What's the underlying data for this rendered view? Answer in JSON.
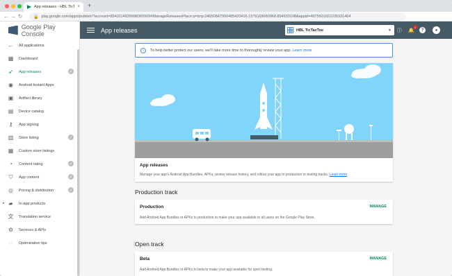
{
  "browser": {
    "tab_title": "App releases - HBL TicTacToe",
    "tab_close": "×",
    "new_tab": "+",
    "url": "play.google.com/apps/publish/?account=8943114839998365509#ManageReleasesPlace:p=tmp.04650847950485420416.1579168660968.894633108&appid=4975501822235331464"
  },
  "brand": {
    "name_part1": "Google Play",
    "name_part2": " Console"
  },
  "sidebar": {
    "items": [
      {
        "label": "All applications",
        "icon": "back-arrow-icon",
        "glyph": "←"
      },
      {
        "label": "Dashboard",
        "icon": "dashboard-icon",
        "glyph": "▦"
      },
      {
        "label": "App releases",
        "icon": "rocket-icon",
        "glyph": "➶"
      },
      {
        "label": "Android Instant Apps",
        "icon": "instant-apps-icon",
        "glyph": "◉"
      },
      {
        "label": "Artifact library",
        "icon": "artifact-icon",
        "glyph": "▣"
      },
      {
        "label": "Device catalog",
        "icon": "device-icon",
        "glyph": "▤"
      },
      {
        "label": "App signing",
        "icon": "key-icon",
        "glyph": "⚷"
      },
      {
        "label": "Store listing",
        "icon": "store-icon",
        "glyph": "▥"
      },
      {
        "label": "Custom store listings",
        "icon": "custom-listing-icon",
        "glyph": "▦"
      },
      {
        "label": "Content rating",
        "icon": "rating-icon",
        "glyph": "◔"
      },
      {
        "label": "App content",
        "icon": "shield-icon",
        "glyph": "⛉"
      },
      {
        "label": "Pricing & distribution",
        "icon": "pricing-icon",
        "glyph": "◎"
      },
      {
        "label": "In-app products",
        "icon": "cart-icon",
        "glyph": "▰"
      },
      {
        "label": "Translation service",
        "icon": "translate-icon",
        "glyph": "文"
      },
      {
        "label": "Services & APIs",
        "icon": "services-icon",
        "glyph": "⚙"
      },
      {
        "label": "Optimization tips",
        "icon": "bulb-icon",
        "glyph": "◌"
      }
    ]
  },
  "topbar": {
    "title": "App releases",
    "app_name": "HBL TicTacToe",
    "notification_count": "1"
  },
  "notice": {
    "text": "To help better protect our users, we'll take more time to thoroughly review your app. ",
    "link": "Learn more"
  },
  "hero": {
    "title": "App releases",
    "description": "Manage your app's Android App Bundles, APKs, review release history, and rollout your app to production or testing tracks. ",
    "link": "Learn more"
  },
  "production": {
    "heading": "Production track",
    "card_title": "Production",
    "manage": "MANAGE",
    "description": "Add Android App Bundles or APKs to production to make your app available to all users on the Google Play Store."
  },
  "open": {
    "heading": "Open track",
    "card_title": "Beta",
    "manage": "MANAGE",
    "description": "Add Android App Bundles or APKs to beta to make your app available for open testing."
  },
  "colors": {
    "accent": "#01875f",
    "topbar": "#455a64",
    "sky": "#81d4fa",
    "link": "#1a73e8"
  }
}
